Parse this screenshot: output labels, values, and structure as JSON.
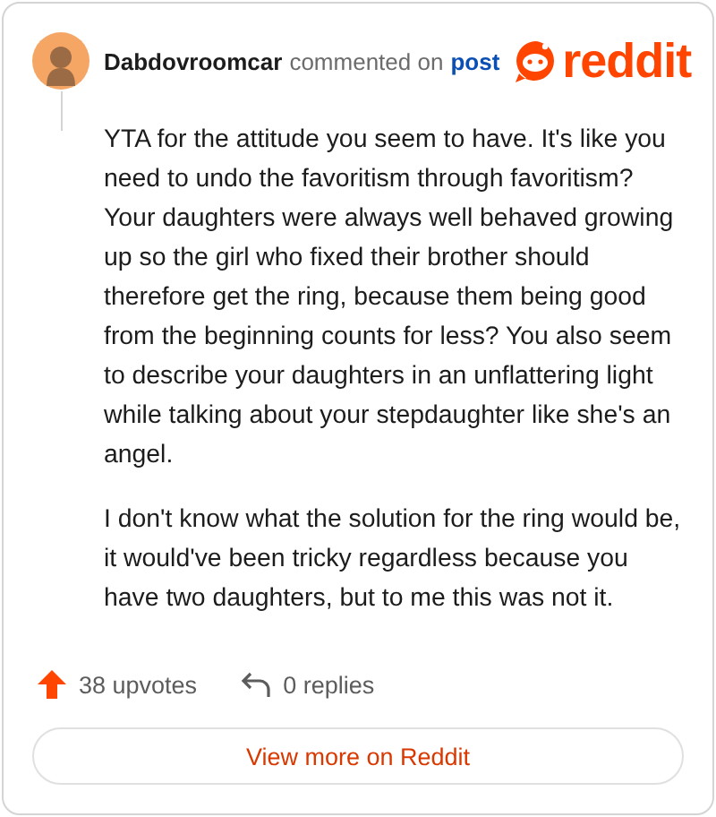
{
  "header": {
    "username": "Dabdovroomcar",
    "action": "commented on",
    "link": "post",
    "logo_text": "reddit"
  },
  "comment": {
    "paragraphs": [
      "YTA for the attitude you seem to have. It's like you need to undo the favoritism through favoritism? Your daughters were always well behaved growing up so the girl who fixed their brother should therefore get the ring, because them being good from the beginning counts for less? You also seem to describe your daughters in an unflattering light while talking about your stepdaughter like she's an angel.",
      "I don't know what the solution for the ring would be, it would've been tricky regardless because you have two daughters, but to me this was not it."
    ]
  },
  "footer": {
    "upvotes": "38 upvotes",
    "replies": "0 replies"
  },
  "button": {
    "label": "View more on Reddit"
  }
}
